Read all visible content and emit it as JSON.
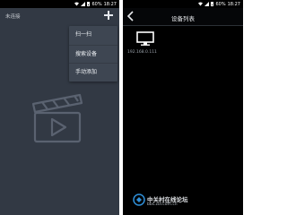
{
  "left_screen": {
    "statusbar": {
      "battery": "60%",
      "time": "18:27"
    },
    "connection_status": "未连接",
    "menu": {
      "items": [
        "扫一扫",
        "搜索设备",
        "手动添加"
      ]
    }
  },
  "right_screen": {
    "statusbar": {
      "battery": "60%",
      "time": "18:27"
    },
    "title": "设备列表",
    "device": {
      "ip": "192.168.0.111"
    },
    "watermark": {
      "title": "中关村在线论坛",
      "url": "bbs.zol.com.cn"
    }
  },
  "colors": {
    "left_background": "#323944",
    "right_background": "#000000",
    "menu_background": "#3e4652",
    "text_light": "#eef1f5"
  }
}
